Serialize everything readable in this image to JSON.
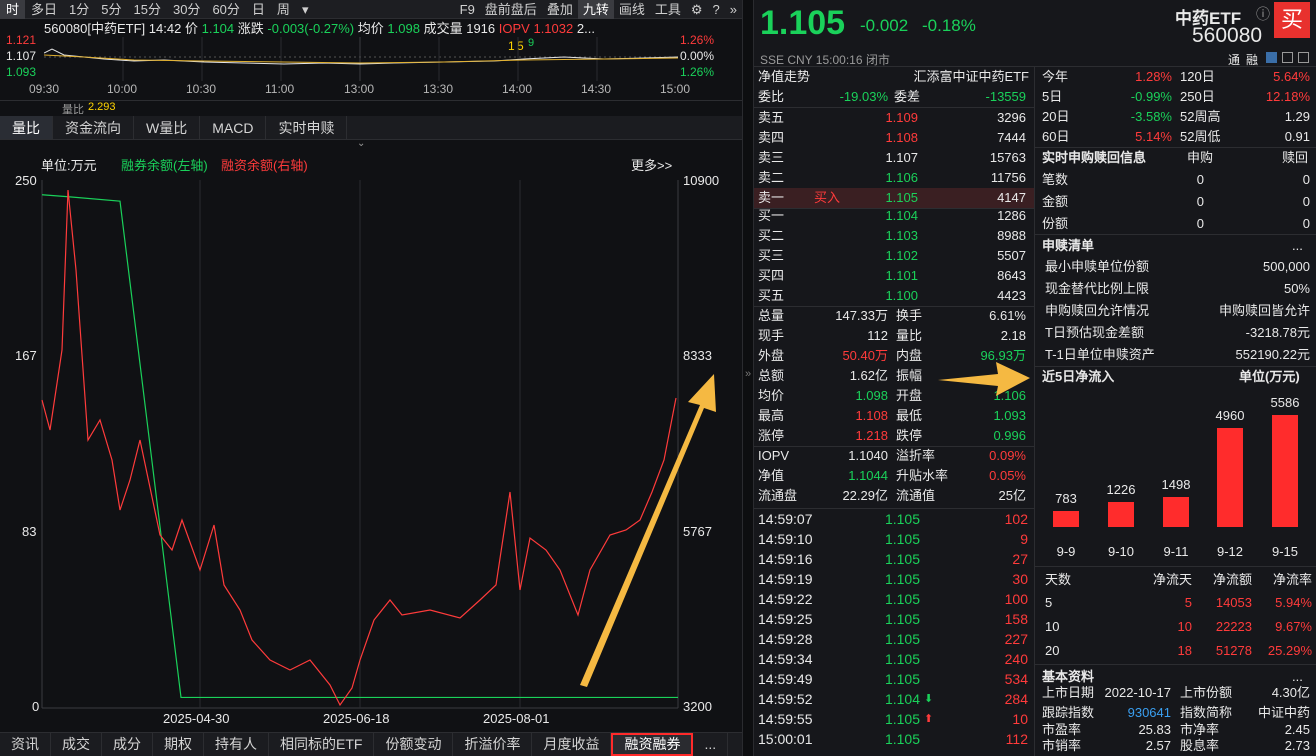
{
  "topbar": {
    "tabs": [
      "时",
      "多日",
      "1分",
      "5分",
      "15分",
      "30分",
      "60分",
      "日",
      "周",
      "▾"
    ],
    "active": 0,
    "right": [
      "F9",
      "盘前盘后",
      "叠加",
      "九转",
      "画线",
      "工具"
    ],
    "right_active": 3
  },
  "mini": {
    "code": "560080[中药ETF]",
    "time": "14:42",
    "price_label": "价",
    "price": "1.104",
    "change_label": "涨跌",
    "change": "-0.003(-0.27%)",
    "avg_label": "均价",
    "avg": "1.098",
    "vol_label": "成交量",
    "vol": "1916",
    "iopv_label": "IOPV",
    "iopv": "1.1032",
    "more": "2...",
    "yl": [
      "1.121",
      "1.107",
      "1.093"
    ],
    "yr": [
      "1.26%",
      "0.00%",
      "1.26%"
    ],
    "times": [
      "09:30",
      "10:00",
      "10:30",
      "11:00",
      "13:00",
      "13:30",
      "14:00",
      "14:30",
      "15:00"
    ],
    "marker_a": "1",
    "marker_b": "5",
    "marker_c": "9",
    "subbar_label": "量比",
    "subbar_value": "2.293"
  },
  "tabs2": [
    "量比",
    "资金流向",
    "W量比",
    "MACD",
    "实时申赎"
  ],
  "chart": {
    "unit": "单位:万元",
    "legend_left": "融券余额(左轴)",
    "legend_right": "融资余额(右轴)",
    "more": "更多>>",
    "yleft": [
      "250",
      "167",
      "83",
      "0"
    ],
    "yright": [
      "10900",
      "8333",
      "5767",
      "3200"
    ],
    "xdates": [
      "2025-04-30",
      "2025-06-18",
      "2025-08-01"
    ]
  },
  "chart_data": {
    "type": "line",
    "x": [
      "2025-03",
      "2025-04-30",
      "2025-06-18",
      "2025-08-01",
      "2025-09-15"
    ],
    "series": [
      {
        "name": "融券余额(左轴)",
        "axis": "left",
        "color": "#1ad15a",
        "values": [
          243,
          242,
          240,
          5,
          5,
          5,
          5,
          5,
          5,
          5,
          5,
          5,
          5
        ]
      },
      {
        "name": "融资余额(右轴)",
        "axis": "right",
        "color": "#ff3b3b",
        "values": [
          6900,
          10800,
          8100,
          5700,
          4200,
          3400,
          3200,
          3800,
          4600,
          4300,
          5300,
          4800,
          5800,
          6100,
          7300
        ]
      }
    ],
    "yleft_range": [
      0,
      250
    ],
    "yright_range": [
      3200,
      10900
    ],
    "grid": true
  },
  "bottom_tabs": [
    "资讯",
    "成交",
    "成分",
    "期权",
    "持有人",
    "相同标的ETF",
    "份额变动",
    "折溢价率",
    "月度收益",
    "融资融券",
    "..."
  ],
  "bottom_active": 9,
  "quote": {
    "price": "1.105",
    "chg": "-0.002",
    "pct": "-0.18%",
    "name": "中药ETF",
    "code": "560080",
    "buy": "买",
    "sub": "SSE  CNY  15:00:16  闭市",
    "tong": "通",
    "rong": "融"
  },
  "ob": {
    "title_l": "净值走势",
    "title_r": "汇添富中证中药ETF",
    "wb_label": "委比",
    "wb": "-19.03%",
    "wc_label": "委差",
    "wc": "-13559",
    "sells": [
      {
        "l": "卖五",
        "p": "1.109",
        "v": "3296",
        "c": "red"
      },
      {
        "l": "卖四",
        "p": "1.108",
        "v": "7444",
        "c": "red"
      },
      {
        "l": "卖三",
        "p": "1.107",
        "v": "15763",
        "c": "wht"
      },
      {
        "l": "卖二",
        "p": "1.106",
        "v": "11756",
        "c": "green"
      },
      {
        "l": "卖一",
        "p": "1.105",
        "v": "4147",
        "c": "green",
        "tag": "买入"
      }
    ],
    "buys": [
      {
        "l": "买一",
        "p": "1.104",
        "v": "1286"
      },
      {
        "l": "买二",
        "p": "1.103",
        "v": "8988"
      },
      {
        "l": "买三",
        "p": "1.102",
        "v": "5507"
      },
      {
        "l": "买四",
        "p": "1.101",
        "v": "8643"
      },
      {
        "l": "买五",
        "p": "1.100",
        "v": "4423"
      }
    ]
  },
  "stats": [
    [
      {
        "l": "总量",
        "v": "147.33万",
        "c": "wht"
      },
      {
        "l": "换手",
        "v": "6.61%",
        "c": "wht"
      }
    ],
    [
      {
        "l": "现手",
        "v": "112",
        "c": "wht"
      },
      {
        "l": "量比",
        "v": "2.18",
        "c": "wht"
      }
    ],
    [
      {
        "l": "外盘",
        "v": "50.40万",
        "c": "red"
      },
      {
        "l": "内盘",
        "v": "96.93万",
        "c": "green"
      }
    ],
    [
      {
        "l": "总额",
        "v": "1.62亿",
        "c": "wht"
      },
      {
        "l": "振幅",
        "v": "",
        "c": "wht"
      }
    ],
    [
      {
        "l": "均价",
        "v": "1.098",
        "c": "green"
      },
      {
        "l": "开盘",
        "v": "1.106",
        "c": "green"
      }
    ],
    [
      {
        "l": "最高",
        "v": "1.108",
        "c": "red"
      },
      {
        "l": "最低",
        "v": "1.093",
        "c": "green"
      }
    ],
    [
      {
        "l": "涨停",
        "v": "1.218",
        "c": "red"
      },
      {
        "l": "跌停",
        "v": "0.996",
        "c": "green"
      }
    ]
  ],
  "stats2": [
    [
      {
        "l": "IOPV",
        "v": "1.1040",
        "c": "wht"
      },
      {
        "l": "溢折率",
        "v": "0.09%",
        "c": "red"
      }
    ],
    [
      {
        "l": "净值",
        "v": "1.1044",
        "c": "green"
      },
      {
        "l": "升贴水率",
        "v": "0.05%",
        "c": "red"
      }
    ],
    [
      {
        "l": "流通盘",
        "v": "22.29亿",
        "c": "wht"
      },
      {
        "l": "流通值",
        "v": "25亿",
        "c": "wht"
      }
    ]
  ],
  "ticks": [
    {
      "t": "14:59:07",
      "p": "1.105",
      "v": "102",
      "a": ""
    },
    {
      "t": "14:59:10",
      "p": "1.105",
      "v": "9",
      "a": ""
    },
    {
      "t": "14:59:16",
      "p": "1.105",
      "v": "27",
      "a": ""
    },
    {
      "t": "14:59:19",
      "p": "1.105",
      "v": "30",
      "a": ""
    },
    {
      "t": "14:59:22",
      "p": "1.105",
      "v": "100",
      "a": ""
    },
    {
      "t": "14:59:25",
      "p": "1.105",
      "v": "158",
      "a": ""
    },
    {
      "t": "14:59:28",
      "p": "1.105",
      "v": "227",
      "a": ""
    },
    {
      "t": "14:59:34",
      "p": "1.105",
      "v": "240",
      "a": ""
    },
    {
      "t": "14:59:49",
      "p": "1.105",
      "v": "534",
      "a": ""
    },
    {
      "t": "14:59:52",
      "p": "1.104",
      "v": "284",
      "a": "down"
    },
    {
      "t": "14:59:55",
      "p": "1.105",
      "v": "10",
      "a": "up"
    },
    {
      "t": "15:00:01",
      "p": "1.105",
      "v": "112",
      "a": ""
    }
  ],
  "perf": [
    [
      {
        "l": "今年",
        "v": "1.28%",
        "c": "red"
      },
      {
        "l": "120日",
        "v": "5.64%",
        "c": "red"
      }
    ],
    [
      {
        "l": "5日",
        "v": "-0.99%",
        "c": "green"
      },
      {
        "l": "250日",
        "v": "12.18%",
        "c": "red"
      }
    ],
    [
      {
        "l": "20日",
        "v": "-3.58%",
        "c": "green"
      },
      {
        "l": "52周高",
        "v": "1.29",
        "c": "wht"
      }
    ],
    [
      {
        "l": "60日",
        "v": "5.14%",
        "c": "red"
      },
      {
        "l": "52周低",
        "v": "0.91",
        "c": "wht"
      }
    ]
  ],
  "sg": {
    "title": "实时申购赎回信息",
    "h1": "申购",
    "h2": "赎回",
    "rows": [
      {
        "l": "笔数",
        "a": "0",
        "b": "0"
      },
      {
        "l": "金额",
        "a": "0",
        "b": "0"
      },
      {
        "l": "份额",
        "a": "0",
        "b": "0"
      }
    ]
  },
  "sq": {
    "title": "申赎清单",
    "more": "...",
    "rows": [
      {
        "l": "最小申赎单位份额",
        "v": "500,000"
      },
      {
        "l": "现金替代比例上限",
        "v": "50%"
      },
      {
        "l": "申购赎回允许情况",
        "v": "申购赎回皆允许"
      },
      {
        "l": "T日预估现金差额",
        "v": "-3218.78元"
      },
      {
        "l": "T-1日单位申赎资产",
        "v": "552190.22元"
      }
    ]
  },
  "flow": {
    "title": "近5日净流入",
    "unit": "单位(万元)",
    "labels": [
      "9-9",
      "9-10",
      "9-11",
      "9-12",
      "9-15"
    ],
    "values": [
      783,
      1226,
      1498,
      4960,
      5586
    ]
  },
  "ft": {
    "h": [
      "天数",
      "净流天",
      "净流额",
      "净流率"
    ],
    "rows": [
      [
        "5",
        "5",
        "14053",
        "5.94%"
      ],
      [
        "10",
        "10",
        "22223",
        "9.67%"
      ],
      [
        "20",
        "18",
        "51278",
        "25.29%"
      ]
    ]
  },
  "basic": {
    "title": "基本资料",
    "more": "...",
    "r1": [
      {
        "l": "上市日期",
        "v": "2022-10-17"
      },
      {
        "l": "上市份额",
        "v": "4.30亿"
      }
    ],
    "r2": [
      {
        "l": "跟踪指数",
        "v": "930641"
      },
      {
        "l": "指数简称",
        "v": "中证中药"
      }
    ],
    "r3": [
      {
        "l": "市盈率",
        "v": "25.83"
      },
      {
        "l": "市净率",
        "v": "2.45"
      }
    ],
    "r4": [
      {
        "l": "市销率",
        "v": "2.57"
      },
      {
        "l": "股息率",
        "v": "2.73"
      }
    ]
  }
}
